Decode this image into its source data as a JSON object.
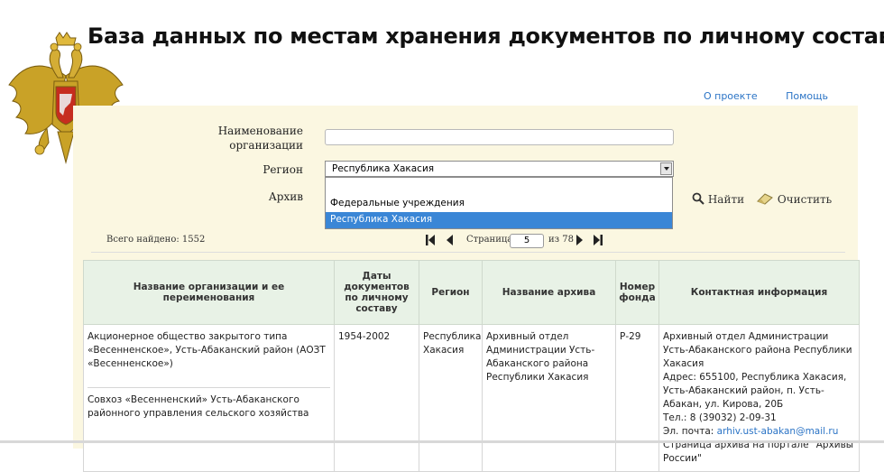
{
  "header": {
    "title": "База данных по местам хранения документов по личному составу",
    "links": [
      "О проекте",
      "Помощь"
    ]
  },
  "search": {
    "org_label_1": "Наименование",
    "org_label_2": "организации",
    "org_value": "",
    "region_label": "Регион",
    "region_value": "Республика Хакасия",
    "region_options": [
      "",
      "Федеральные учреждения",
      "Республика Хакасия"
    ],
    "archive_label": "Архив",
    "find_label": "Найти",
    "clear_label": "Очистить"
  },
  "results": {
    "found_text": "Всего найдено: 1552",
    "page_label": "Страница",
    "page_value": "5",
    "of_text": "из 78"
  },
  "table": {
    "headers": [
      "Название организации и ее переименования",
      "Даты документов по личному составу",
      "Регион",
      "Название архива",
      "Номер фонда",
      "Контактная информация"
    ],
    "row": {
      "org_1": "Акционерное общество закрытого типа «Весенненское», Усть-Абаканский район (АОЗТ «Весенненское»)",
      "org_2": "Совхоз «Весенненский» Усть-Абаканского районного управления сельского хозяйства",
      "dates": "1954-2002",
      "region": "Республика Хакасия",
      "archive": "Архивный отдел Администрации Усть-Абаканского района Республики Хакасия",
      "fond": "Р-29",
      "contact_1": "Архивный отдел Администрации Усть-Абаканского района Республики Хакасия",
      "contact_2": "Адрес: 655100, Республика Хакасия, Усть-Абаканский район, п. Усть-Абакан, ул. Кирова, 20Б",
      "contact_3": "Тел.: 8 (39032) 2-09-31",
      "email_label": "Эл. почта: ",
      "email": "arhiv.ust-abakan@mail.ru",
      "contact_4": "Страница архива на портале \"Архивы России\""
    }
  },
  "colors": {
    "panel": "#fbf7e1",
    "header_row": "#e8f2e6",
    "link": "#2b74c6",
    "selected": "#3a86d6"
  }
}
